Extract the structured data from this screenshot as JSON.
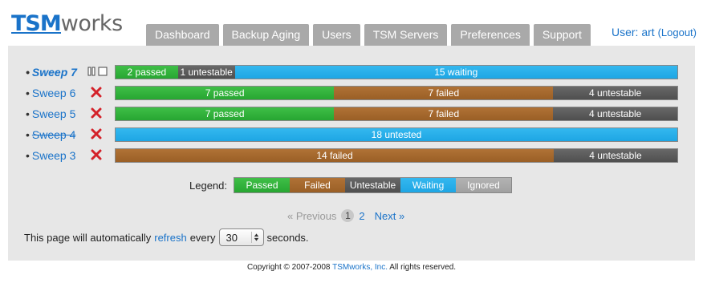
{
  "header": {
    "logo_tsm": "TSM",
    "logo_works": "works",
    "tabs": [
      "Dashboard",
      "Backup Aging",
      "Users",
      "TSM Servers",
      "Preferences",
      "Support"
    ],
    "user_label": "User: art",
    "logout_label": "(Logout)"
  },
  "colors": {
    "passed": "#2fb43b",
    "failed": "#a86a2e",
    "untestable": "#5a5a5a",
    "waiting": "#28aeea",
    "ignored": "#aaaaaa",
    "link": "#1a73c9"
  },
  "sweeps": [
    {
      "label": "Sweep 7",
      "status_icon": "pause-stop-icons",
      "segments": [
        {
          "label": "2 passed",
          "status": "passed",
          "count": 2
        },
        {
          "label": "1 untestable",
          "status": "untestable",
          "count": 1
        },
        {
          "label": "15 waiting",
          "status": "waiting",
          "count": 15
        }
      ]
    },
    {
      "label": "Sweep 6",
      "status_icon": "red-x-icon",
      "segments": [
        {
          "label": "7 passed",
          "status": "passed",
          "count": 7
        },
        {
          "label": "7 failed",
          "status": "failed",
          "count": 7
        },
        {
          "label": "4 untestable",
          "status": "untestable",
          "count": 4
        }
      ]
    },
    {
      "label": "Sweep 5",
      "status_icon": "red-x-icon",
      "segments": [
        {
          "label": "7 passed",
          "status": "passed",
          "count": 7
        },
        {
          "label": "7 failed",
          "status": "failed",
          "count": 7
        },
        {
          "label": "4 untestable",
          "status": "untestable",
          "count": 4
        }
      ]
    },
    {
      "label": "Sweep 4",
      "status_icon": "red-x-icon",
      "segments": [
        {
          "label": "18 untested",
          "status": "waiting",
          "count": 18
        }
      ]
    },
    {
      "label": "Sweep 3",
      "status_icon": "red-x-icon",
      "segments": [
        {
          "label": "14 failed",
          "status": "failed",
          "count": 14
        },
        {
          "label": "4 untestable",
          "status": "untestable",
          "count": 4
        }
      ]
    }
  ],
  "legend": {
    "label": "Legend:",
    "items": [
      {
        "label": "Passed",
        "status": "passed"
      },
      {
        "label": "Failed",
        "status": "failed"
      },
      {
        "label": "Untestable",
        "status": "untestable"
      },
      {
        "label": "Waiting",
        "status": "waiting"
      },
      {
        "label": "Ignored",
        "status": "ignored"
      }
    ]
  },
  "pagination": {
    "prev_label": "« Previous",
    "current_page": "1",
    "other_page": "2",
    "next_label": "Next »"
  },
  "refresh": {
    "prefix": "This page will automatically",
    "link": "refresh",
    "middle": "every",
    "value": "30",
    "suffix": "seconds."
  },
  "footer": {
    "prefix": "Copyright © 2007-2008",
    "link": "TSMworks, Inc.",
    "suffix": "All rights reserved."
  }
}
